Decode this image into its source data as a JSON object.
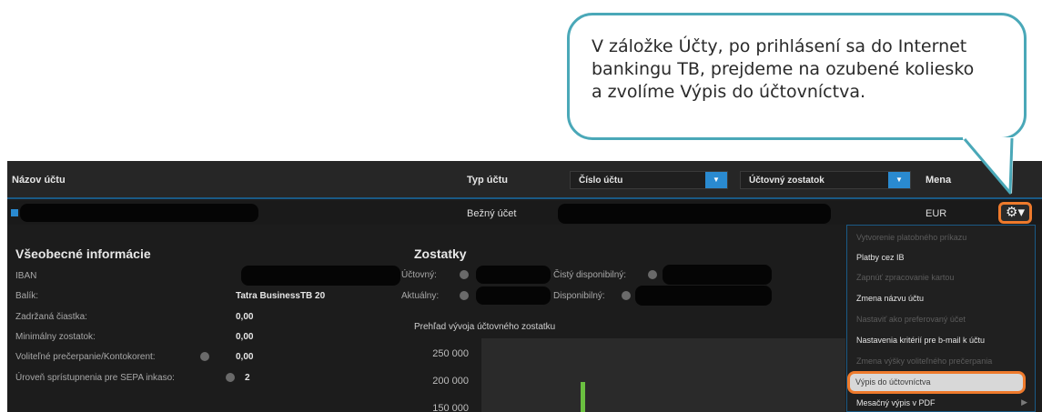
{
  "callout": {
    "line1": "V záložke Účty, po prihlásení sa do Internet",
    "line2": "bankingu TB, prejdeme na ozubené koliesko",
    "line3": "a zvolíme Výpis do účtovníctva."
  },
  "table_header": {
    "account_name": "Názov účtu",
    "account_type": "Typ účtu",
    "account_number_select": "Číslo účtu",
    "balance_select": "Účtovný zostatok",
    "currency": "Mena"
  },
  "account_row": {
    "type": "Bežný účet",
    "currency": "EUR"
  },
  "general_info": {
    "title": "Všeobecné informácie",
    "rows": [
      {
        "label": "IBAN",
        "value": ""
      },
      {
        "label": "Balík:",
        "value": "Tatra BusinessTB 20"
      },
      {
        "label": "Zadržaná čiastka:",
        "value": "0,00"
      },
      {
        "label": "Minimálny zostatok:",
        "value": "0,00"
      },
      {
        "label": "Voliteľné prečerpanie/Kontokorent:",
        "value": "0,00"
      },
      {
        "label": "Úroveň sprístupnenia pre SEPA inkaso:",
        "value": "2"
      }
    ]
  },
  "balances": {
    "title": "Zostatky",
    "accounting": "Účtovný:",
    "current": "Aktuálny:",
    "net_available": "Čistý disponibilný:",
    "available": "Disponibilný:"
  },
  "chart": {
    "title": "Prehľad vývoja účtovného zostatku",
    "ticks": [
      "250 000",
      "200 000",
      "150 000"
    ]
  },
  "menu": {
    "items": [
      {
        "label": "Vytvorenie platobného príkazu",
        "disabled": true
      },
      {
        "label": "Platby cez IB",
        "disabled": false
      },
      {
        "label": "Zapnúť zpracovanie kartou",
        "disabled": true
      },
      {
        "label": "Zmena názvu účtu",
        "disabled": false
      },
      {
        "label": "Nastaviť ako preferovaný účet",
        "disabled": true
      },
      {
        "label": "Nastavenia kritérií pre b-mail k účtu",
        "disabled": false
      },
      {
        "label": "Zmena výšky voliteľného prečerpania",
        "disabled": true
      },
      {
        "label": "Výpis do účtovníctva",
        "disabled": false,
        "highlighted": true
      },
      {
        "label": "Mesačný výpis v PDF",
        "disabled": false
      }
    ]
  },
  "colors": {
    "accent_blue": "#2a8ad0",
    "highlight_orange": "#ee7a2c",
    "callout_border": "#4aa8b8",
    "panel_bg": "#1c1c1c"
  },
  "icons": {
    "gear": "gear-icon",
    "dropdown": "chevron-down-icon",
    "submenu": "chevron-right-icon",
    "info": "info-icon",
    "expand": "expand-icon"
  }
}
